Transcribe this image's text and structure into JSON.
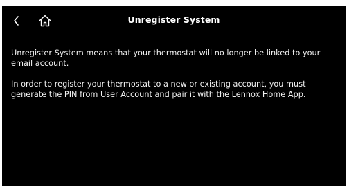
{
  "header": {
    "title": "Unregister System",
    "back_icon": "chevron-left-icon",
    "home_icon": "home-icon"
  },
  "content": {
    "paragraph_1": "Unregister System means that your thermostat will no longer be linked to your email account.",
    "paragraph_2": "In order to register your thermostat to a new or existing account, you must generate the PIN from User Account and pair it with the Lennox Home App."
  },
  "colors": {
    "background": "#000000",
    "text": "#f2f2f2",
    "bezel": "#ffffff"
  }
}
